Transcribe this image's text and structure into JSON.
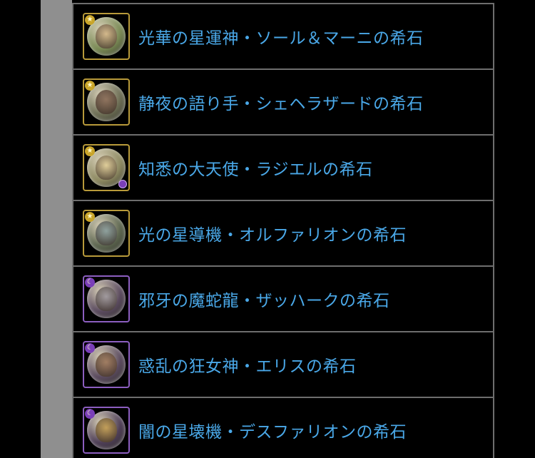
{
  "colors": {
    "link_text": "#4aa8e8",
    "background": "#000000",
    "rail": "#8f8f8f",
    "divider": "#6e6e6e",
    "light_frame": "#b89a3a",
    "dark_frame": "#8c5ec0"
  },
  "items": [
    {
      "label": "光華の星運神・ソール＆マーニの希石",
      "attribute": "light",
      "attr_glyph": "★",
      "has_sub": false,
      "orb_color": "#7a8a55",
      "face_color": "#d9b98a"
    },
    {
      "label": "静夜の語り手・シェヘラザードの希石",
      "attribute": "light",
      "attr_glyph": "★",
      "has_sub": false,
      "orb_color": "#6d6e55",
      "face_color": "#8a6a55"
    },
    {
      "label": "知悉の大天使・ラジエルの希石",
      "attribute": "light",
      "attr_glyph": "★",
      "has_sub": true,
      "orb_color": "#8e8a62",
      "face_color": "#e6d29a"
    },
    {
      "label": "光の星導機・オルファリオンの希石",
      "attribute": "light",
      "attr_glyph": "★",
      "has_sub": false,
      "orb_color": "#5d6650",
      "face_color": "#8aa0a0"
    },
    {
      "label": "邪牙の魔蛇龍・ザッハークの希石",
      "attribute": "dark",
      "attr_glyph": "☾",
      "has_sub": false,
      "orb_color": "#5a4a5e",
      "face_color": "#a09aa0"
    },
    {
      "label": "惑乱の狂女神・エリスの希石",
      "attribute": "dark",
      "attr_glyph": "☾",
      "has_sub": false,
      "orb_color": "#5a4a5e",
      "face_color": "#a0785a"
    },
    {
      "label": "闇の星壊機・デスファリオンの希石",
      "attribute": "dark",
      "attr_glyph": "☾",
      "has_sub": false,
      "orb_color": "#4e3e56",
      "face_color": "#c8a050"
    }
  ]
}
